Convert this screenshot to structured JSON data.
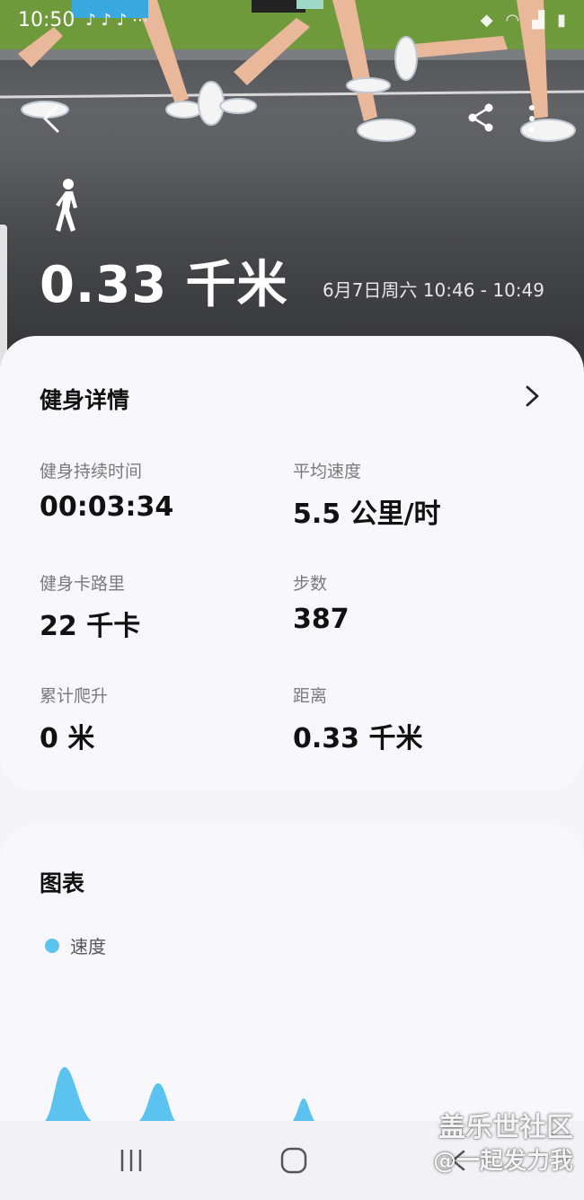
{
  "status_bar": {
    "time": "10:50"
  },
  "hero": {
    "distance": "0.33 千米",
    "date_range": "6月7日周六 10:46 - 10:49",
    "activity_icon": "walking-person-icon"
  },
  "details": {
    "title": "健身详情",
    "metrics": [
      {
        "label": "健身持续时间",
        "value": "00:03:34"
      },
      {
        "label": "平均速度",
        "value": "5.5 公里/时"
      },
      {
        "label": "健身卡路里",
        "value": "22 千卡"
      },
      {
        "label": "步数",
        "value": "387"
      },
      {
        "label": "累计爬升",
        "value": "0 米"
      },
      {
        "label": "距离",
        "value": "0.33 千米"
      }
    ]
  },
  "chart": {
    "title": "图表",
    "legend_label": "速度",
    "legend_color": "#5cc3ee"
  },
  "watermark": {
    "line1": "盖乐世社区",
    "line2": "@一起发力我"
  },
  "colors": {
    "card_bg": "#f8f8fc",
    "accent": "#5cc3ee"
  }
}
